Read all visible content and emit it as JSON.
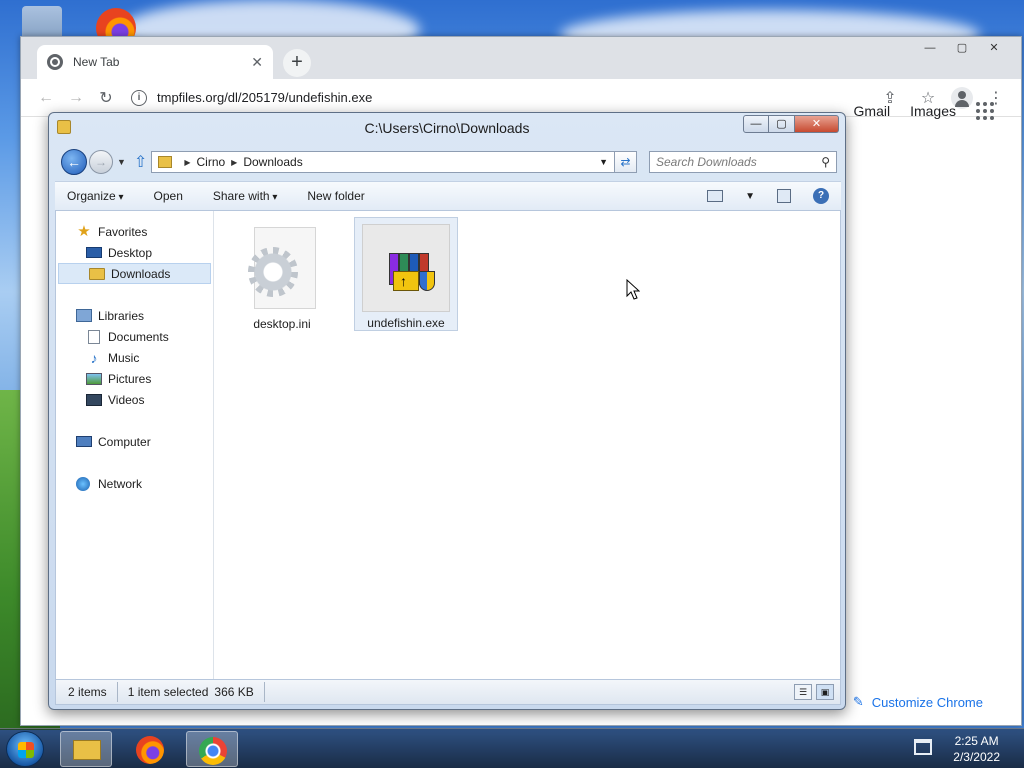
{
  "chrome": {
    "tab_title": "New Tab",
    "tab_close": "✕",
    "new_tab": "+",
    "window_controls": [
      "—",
      "▢",
      "✕"
    ],
    "url": "tmpfiles.org/dl/205179/undefishin.exe",
    "google_links": [
      "Gmail",
      "Images"
    ],
    "customize_label": "Customize Chrome"
  },
  "explorer": {
    "title": "C:\\Users\\Cirno\\Downloads",
    "window_controls": [
      "—",
      "▢",
      "✕"
    ],
    "breadcrumb": [
      "Cirno",
      "Downloads"
    ],
    "search_placeholder": "Search Downloads",
    "toolbar": {
      "organize": "Organize",
      "open": "Open",
      "share_with": "Share with",
      "new_folder": "New folder",
      "help": "?"
    },
    "nav": {
      "favorites": "Favorites",
      "desktop": "Desktop",
      "downloads": "Downloads",
      "libraries": "Libraries",
      "documents": "Documents",
      "music": "Music",
      "pictures": "Pictures",
      "videos": "Videos",
      "computer": "Computer",
      "network": "Network"
    },
    "files": [
      {
        "name": "desktop.ini",
        "icon": "settings-file-icon",
        "selected": false
      },
      {
        "name": "undefishin.exe",
        "icon": "winrar-installer-icon",
        "selected": true
      }
    ],
    "status": {
      "items": "2 items",
      "selected": "1 item selected",
      "size": "366 KB"
    }
  },
  "taskbar": {
    "pinned": [
      "explorer",
      "firefox",
      "chrome"
    ],
    "active": "explorer",
    "time": "2:25 AM",
    "date": "2/3/2022"
  }
}
